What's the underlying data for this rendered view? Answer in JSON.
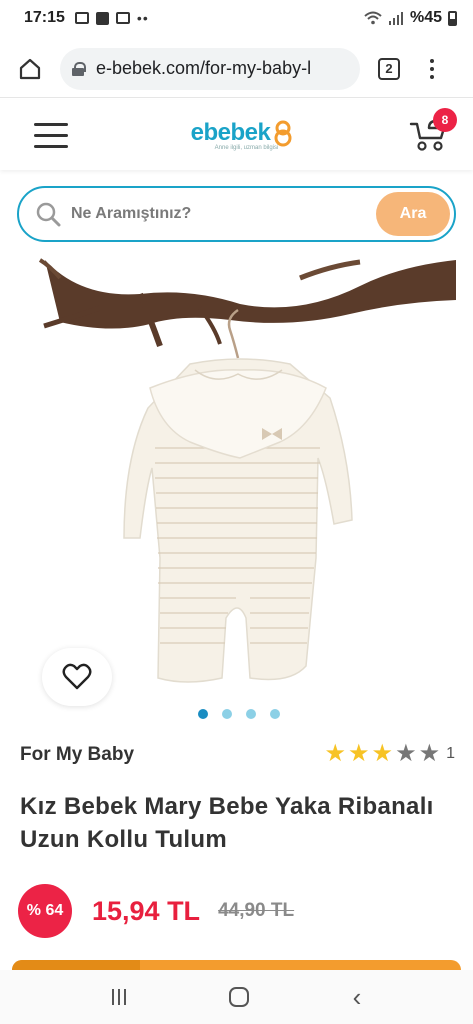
{
  "status_bar": {
    "time": "17:15",
    "battery": "%45"
  },
  "browser": {
    "url": "e-bebek.com/for-my-baby-l",
    "tab_count": "2"
  },
  "header": {
    "logo_text": "ebebek",
    "logo_tagline": "Anne ilgili, uzman bilgisi",
    "cart_count": "8"
  },
  "search": {
    "placeholder": "Ne Aramıştınız?",
    "button_label": "Ara"
  },
  "carousel": {
    "slides": 4,
    "active": 0
  },
  "product": {
    "brand": "For My Baby",
    "rating": 3,
    "rating_max": 5,
    "rating_count": "1",
    "title": "Kız Bebek Mary Bebe Yaka Ribanalı Uzun Kollu Tulum",
    "discount": "% 64",
    "price": "15,94 TL",
    "old_price": "44,90 TL"
  },
  "colors": {
    "brand_blue": "#1aa3c8",
    "accent_orange": "#f6b679",
    "price_red": "#e8203e",
    "star_yellow": "#f7c325"
  }
}
